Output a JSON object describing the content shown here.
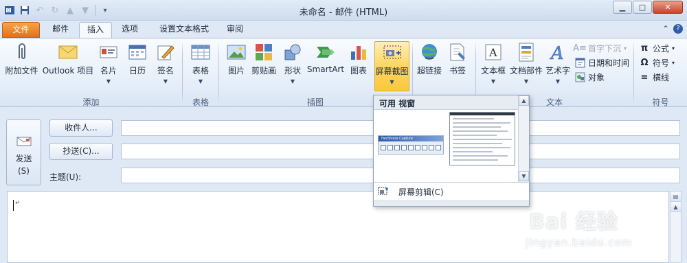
{
  "window": {
    "title": "未命名 - 邮件 (HTML)",
    "quick_access": [
      "save-icon",
      "undo-icon",
      "redo-icon",
      "up-arrow-icon",
      "down-arrow-icon",
      "customize-icon"
    ],
    "controls": [
      "minimize",
      "maximize",
      "close"
    ]
  },
  "tabs": {
    "file": "文件",
    "items": [
      "邮件",
      "插入",
      "选项",
      "设置文本格式",
      "审阅"
    ],
    "active": "插入"
  },
  "ribbon": {
    "groups": [
      {
        "name": "添加",
        "buttons": [
          {
            "label": "附加文件",
            "icon": "paperclip-icon"
          },
          {
            "label": "Outlook 项目",
            "icon": "envelope-icon"
          },
          {
            "label": "名片",
            "icon": "business-card-icon",
            "dropdown": true
          },
          {
            "label": "日历",
            "icon": "calendar-icon"
          },
          {
            "label": "签名",
            "icon": "signature-icon",
            "dropdown": true
          }
        ]
      },
      {
        "name": "表格",
        "buttons": [
          {
            "label": "表格",
            "icon": "table-icon",
            "dropdown": true
          }
        ]
      },
      {
        "name": "插图",
        "buttons": [
          {
            "label": "图片",
            "icon": "picture-icon"
          },
          {
            "label": "剪贴画",
            "icon": "clipart-icon"
          },
          {
            "label": "形状",
            "icon": "shapes-icon",
            "dropdown": true
          },
          {
            "label": "SmartArt",
            "icon": "smartart-icon"
          },
          {
            "label": "图表",
            "icon": "chart-icon"
          },
          {
            "label": "屏幕截图",
            "icon": "screenshot-icon",
            "dropdown": true,
            "active": true
          }
        ]
      },
      {
        "name": "",
        "buttons": [
          {
            "label": "超链接",
            "icon": "hyperlink-icon"
          },
          {
            "label": "书签",
            "icon": "bookmark-icon"
          }
        ]
      },
      {
        "name": "文本",
        "buttons": [
          {
            "label": "文本框",
            "icon": "textbox-icon",
            "dropdown": true
          },
          {
            "label": "文档部件",
            "icon": "quickparts-icon",
            "dropdown": true
          },
          {
            "label": "艺术字",
            "icon": "wordart-icon",
            "dropdown": true
          }
        ],
        "small_buttons": [
          {
            "label": "首字下沉",
            "icon": "dropcap-icon",
            "disabled": true
          },
          {
            "label": "日期和时间",
            "icon": "datetime-icon"
          },
          {
            "label": "对象",
            "icon": "object-icon"
          }
        ]
      },
      {
        "name": "符号",
        "small_buttons": [
          {
            "label": "公式",
            "icon": "pi-icon",
            "dropdown": true
          },
          {
            "label": "符号",
            "icon": "omega-icon",
            "dropdown": true
          },
          {
            "label": "横线",
            "icon": "horizontal-line-icon"
          }
        ]
      }
    ]
  },
  "compose": {
    "send_label": "发送",
    "send_hotkey": "(S)",
    "to_button": "收件人...",
    "cc_button": "抄送(C)...",
    "subject_label": "主题(U):",
    "to_value": "",
    "cc_value": "",
    "subject_value": "",
    "body_marker": "↵"
  },
  "screenshot_gallery": {
    "header": "可用 视窗",
    "window_thumbnails": [
      {
        "caption": "FastStone Capture"
      },
      {
        "caption": ""
      }
    ],
    "clip_label": "屏幕剪辑(C)"
  },
  "watermark": {
    "brand": "Bai 经验",
    "url": "jingyan.baidu.com"
  }
}
